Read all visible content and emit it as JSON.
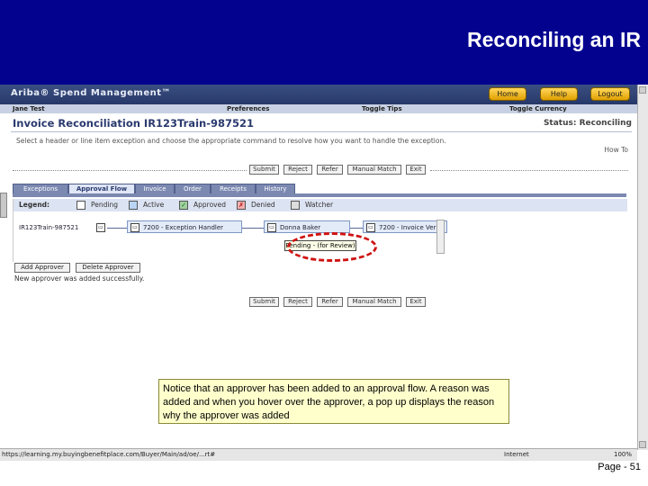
{
  "slide": {
    "title": "Reconciling an IR",
    "page_number": "Page - 51",
    "callout": "Notice that an approver has been added to an approval flow.  A reason was added and when you hover over the approver, a pop up displays the reason why the approver was added"
  },
  "app": {
    "brand": "Ariba® Spend Management™",
    "top_buttons": {
      "home": "Home",
      "help": "Help",
      "logout": "Logout"
    },
    "menu": {
      "user": "Jane Test",
      "preferences": "Preferences",
      "toggle_tips": "Toggle Tips",
      "toggle_currency": "Toggle Currency"
    },
    "page_title": "Invoice Reconciliation IR123Train-987521",
    "status": "Status: Reconciling",
    "instructions": "Select a header or line item exception and choose the appropriate command to resolve how you want to handle the exception.",
    "how_to": "How To",
    "actions": {
      "submit": "Submit",
      "reject": "Reject",
      "refer": "Refer",
      "manual_match": "Manual Match",
      "exit": "Exit"
    },
    "bottom_actions": {
      "submit": "Submit",
      "reject": "Reject",
      "refer": "Refer",
      "manual_match": "Manual Match",
      "exit": "Exit"
    },
    "tabs": [
      "Exceptions",
      "Approval Flow",
      "Invoice",
      "Order",
      "Receipts",
      "History"
    ],
    "legend": {
      "label": "Legend:",
      "pending": "Pending",
      "active": "Active",
      "approved": "Approved",
      "denied": "Denied",
      "watcher": "Watcher"
    },
    "flow": {
      "start_node": "IR123Train-987521",
      "node1": "7200 - Exception Handler",
      "node2": "Donna Baker",
      "node3": "7200 - Invoice Ver"
    },
    "popup_text": "Pending - (for Review)",
    "buttons": {
      "add_approver": "Add Approver",
      "delete_approver": "Delete Approver"
    },
    "success_message": "New approver was added successfully.",
    "status_bar": {
      "url": "https://learning.my.buyingbenefitplace.com/Buyer/Main/ad/oe/...rt#",
      "zone": "Internet",
      "zoom": "100%"
    }
  }
}
